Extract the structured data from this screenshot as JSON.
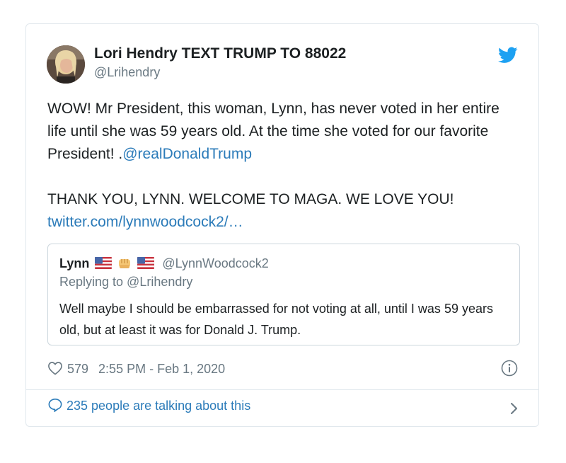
{
  "author": {
    "name": "Lori Hendry TEXT TRUMP TO 88022",
    "handle": "@Lrihendry"
  },
  "tweet": {
    "text_line1": "WOW! Mr President, this woman, Lynn, has never voted in her entire life until she was 59 years old. At the time she voted for our favorite President! .",
    "mention": "@realDonaldTrump",
    "text_line2": "THANK YOU, LYNN. WELCOME TO MAGA. WE LOVE YOU!",
    "link": "twitter.com/lynnwoodcock2/…"
  },
  "quoted": {
    "name": "Lynn",
    "handle": "@LynnWoodcock2",
    "reply_to": "Replying to @Lrihendry",
    "text": "Well maybe I should be embarrassed for not voting at all, until I was 59 years old, but at least it was for Donald J. Trump."
  },
  "meta": {
    "likes": "579",
    "timestamp": "2:55 PM - Feb 1, 2020"
  },
  "conversation": {
    "label": "235 people are talking about this"
  },
  "colors": {
    "link": "#2b7bb9",
    "twitter_blue": "#1da1f2",
    "secondary_text": "#697882",
    "border": "#e1e8ed"
  },
  "icons": [
    "twitter-bird-icon",
    "heart-icon",
    "info-icon",
    "speech-bubble-icon",
    "chevron-right-icon",
    "us-flag-icon",
    "fist-icon"
  ]
}
